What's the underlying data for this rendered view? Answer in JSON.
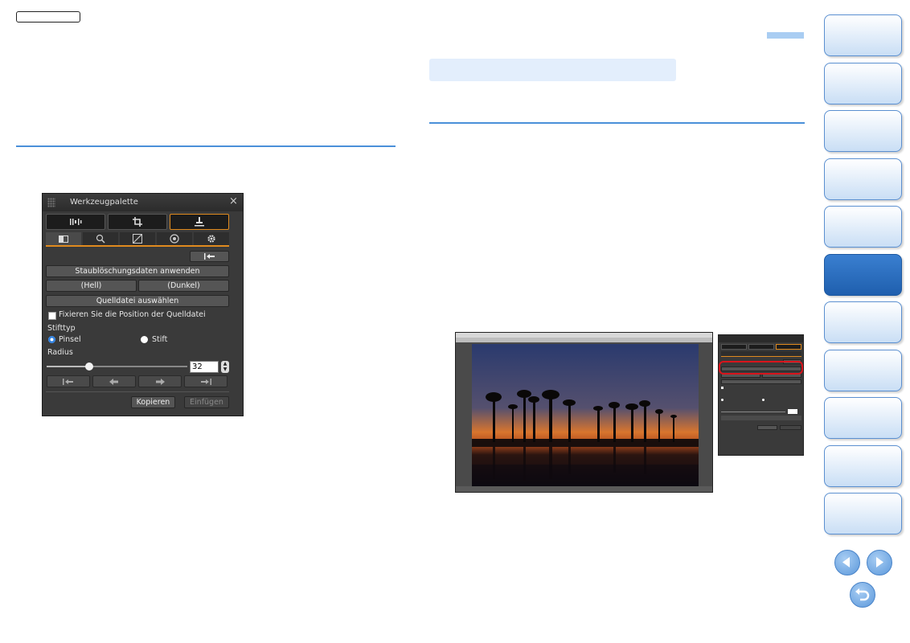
{
  "palette": {
    "title": "Werkzeugpalette",
    "close_icon": "×",
    "apply_button": "Staublöschungsdaten anwenden",
    "light_button": "(Hell)",
    "dark_button": "(Dunkel)",
    "select_source_button": "Quelldatei auswählen",
    "fix_position_label": "Fixieren Sie die Position der Quelldatei",
    "pen_type_label": "Stifttyp",
    "brush_label": "Pinsel",
    "pen_label": "Stift",
    "radius_label": "Radius",
    "radius_value": "32",
    "radius_fraction": 0.3,
    "copy_button": "Kopieren",
    "paste_button": "Einfügen"
  },
  "colors": {
    "rule_blue": "#4a90d9",
    "active_orange": "#e08a1e",
    "highlight_red": "#d9141c",
    "nav_active": "#1f5fae"
  },
  "icons": {
    "rgb_tab": "brightness-tool-icon",
    "crop_tab": "crop-icon",
    "stamp_tab": "stamp-icon",
    "nav_prev": "arrow-left-icon",
    "nav_next": "arrow-right-icon",
    "nav_return": "return-icon"
  }
}
